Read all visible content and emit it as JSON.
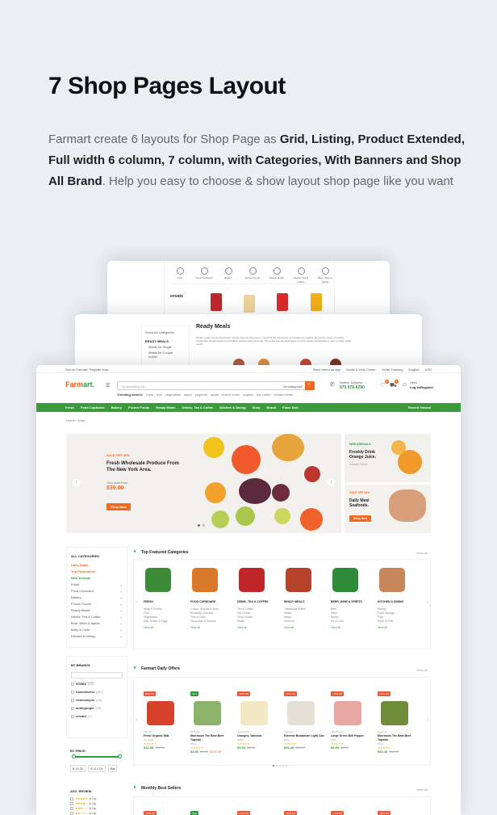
{
  "heading": "7 Shop Pages Layout",
  "intro": {
    "lead": "Farmart create 6 layouts for Shop Page as ",
    "bold": "Grid, Listing, Product Extended, Full width 6 column, 7 column, with Categories, With Banners and Shop All Brand",
    "tail": ". Help you easy to choose  & show layout shop page like you want"
  },
  "card1": {
    "categories": [
      "Fruit",
      "Food Cupboard",
      "Bakery",
      "Frozen Foods",
      "Ready Meals",
      "Drinks, Tea & Coffee",
      "Beer, Wine & Spirits"
    ],
    "brand": "envato"
  },
  "card2": {
    "sidebar_label": "Show All Categories",
    "sidebar_heading": "READY MEALS",
    "sidebar_items": [
      "Meals for Single",
      "Meals for Couple",
      "Indian"
    ],
    "title": "Ready Meals",
    "description": "Ready meals can be tempting for people who are time poor to overlook the importance of a balanced, healthy diet but the range of healthy, nutritionally sound options is constantly growing and improving. There are several advantages for busy people and families to turn to ready-made meals."
  },
  "shop": {
    "topbar_left": "Sell on Farmart: Register Now",
    "topbar_right": [
      "Store menu on app",
      "Guide & Help Center",
      "Order Tracking",
      "English",
      "USD"
    ],
    "logo_main": "Farm",
    "logo_accent": "art.",
    "search_placeholder": "I'm searching for...",
    "search_category": "All categories",
    "trending_label": "Trending search:",
    "trending": [
      "meat",
      "fruit",
      "vegetables",
      "salad",
      "yoghurts",
      "apple",
      "frozen foods",
      "organic",
      "tea coffee",
      "instant meals"
    ],
    "hotline_label": "Hotline Delivery",
    "hotline": "970 978-6290",
    "account_hello": "Hello",
    "account_login": "Log in/Register",
    "cart_count": "0",
    "wish_count": "0",
    "nav": [
      "Fresh",
      "Food Cupboard",
      "Bakery",
      "Frozen Foods",
      "Ready Meals",
      "Drinks, Tea & Coffee",
      "Kitchen & Dining",
      "Shop",
      "Brand",
      "Flash Sale"
    ],
    "nav_right": "Recent Viewed",
    "breadcrumb": "Home / Shop",
    "hero": {
      "sale": "SALE OFF 30%",
      "title": "Fresh Wholesale Produce From The New York Area.",
      "price_label": "Only start from",
      "price": "$39.00",
      "button": "Shop Now"
    },
    "banner1": {
      "tag": "NEW ARRIVALS",
      "title": "Freshly Drink Orange Juice.",
      "note": "Instant Drink"
    },
    "banner2": {
      "tag": "SALE OFF 30%",
      "title": "Daily Meal Seafoods.",
      "button": "Shop Now"
    },
    "sidebar": {
      "all_categories": "ALL CATEGORIES",
      "highlight": [
        "Daily Deals",
        "Top Promotions",
        "New Arrivals"
      ],
      "categories": [
        "Fresh",
        "Food Cupboard",
        "Bakery",
        "Frozen Foods",
        "Ready Meals",
        "Drinks, Tea & Coffee",
        "Beer, Wine & Spirits",
        "Baby & Child",
        "Kitchen & Dining"
      ],
      "by_brands": "BY BRANDS",
      "brand_search": "Search brand",
      "brands": [
        {
          "name": "envato",
          "count": "(19)"
        },
        {
          "name": "themeforest",
          "count": "(567)"
        },
        {
          "name": "codecanyon",
          "count": "(40)"
        },
        {
          "name": "audiojungle",
          "count": "(75)"
        },
        {
          "name": "envato",
          "count": "(7)"
        }
      ],
      "by_price": "BY PRICE",
      "price_min": "$ 15.00",
      "price_max": "$ 112.00",
      "price_go": "Go",
      "avg_review": "AVG. REVIEW",
      "review_rows": [
        "& Up",
        "& Up",
        "& Up",
        "& Up"
      ]
    },
    "featured": {
      "title": "Top Featured Categories",
      "view_all": "View all",
      "items": [
        {
          "name": "FRESH",
          "subs": [
            "Meat & Poultry",
            "Fruit",
            "Vegetables",
            "Milk, Butter & Eggs"
          ],
          "color": "#3d8b37"
        },
        {
          "name": "FOOD CUPBOARD",
          "subs": [
            "Crisps, Snacks & Nuts",
            "Breakfast Cereals",
            "Tins & Cans",
            "Chocolate & Sweets"
          ],
          "color": "#d97a2b"
        },
        {
          "name": "DRINK, TEA & COFFEE",
          "subs": [
            "Tea & Coffee",
            "Hot Drinks",
            "Fizzy Drinks",
            "Water"
          ],
          "color": "#c0252a"
        },
        {
          "name": "READY MEALS",
          "subs": [
            "Traditional British",
            "Indian",
            "Italian",
            "Chinese"
          ],
          "color": "#b5432b"
        },
        {
          "name": "BEER, WINE & SPIRITS",
          "subs": [
            "Beer",
            "Wine",
            "Spirits",
            "Rs & Cold"
          ],
          "color": "#2f8a3a"
        },
        {
          "name": "KITCHEN & DINING",
          "subs": [
            "Dining",
            "Food Storage",
            "Pots",
            "Pans & Pots"
          ],
          "color": "#c8875a"
        }
      ],
      "view_label": "View all"
    },
    "daily": {
      "title": "Farmart Daily Offers",
      "view_all": "View all",
      "items": [
        {
          "badge": "20% Off",
          "brand": "Farmart",
          "name": "Fresh Organic Milk",
          "unit": "4 pt pack",
          "price": "$12.99",
          "old": "$16.99",
          "color": "#e85a3a",
          "img": "#d8412b"
        },
        {
          "badge": "New",
          "brand": "Pinterest",
          "name": "Morrisons The Best Beef Topside",
          "unit": "500g",
          "price": "$4.90",
          "old": "$5.90",
          "save": "50% Off",
          "color": "#2e9c3c",
          "img": "#8bb46a"
        },
        {
          "badge": "-10% Off",
          "brand": "Alisa Farm",
          "name": "Oranges, Valencia",
          "unit": "6000m",
          "price": "$4.90",
          "old": "$5.99",
          "color": "#e85a3a",
          "img": "#f0e9c4"
        },
        {
          "badge": "-22% Off",
          "brand": "Logovue",
          "name": "Extreme Budweiser Light Can",
          "unit": "500g",
          "price": "$52.49",
          "old": "$65.99",
          "color": "#e85a3a",
          "img": "#e6e1d7"
        },
        {
          "badge": "-45% Off",
          "brand": "Alisa Farm",
          "name": "Large Green Bell Pepper",
          "unit": "500g",
          "price": "$4.99",
          "old": "$6.99",
          "color": "#e85a3a",
          "img": "#e8a7a0"
        },
        {
          "badge": "-32% Off",
          "brand": "Logovue",
          "name": "Morrisons The Best Beef Topside",
          "unit": "500g",
          "price": "$52.49",
          "old": "$66.99",
          "color": "#e85a3a",
          "img": "#6f8d3b"
        }
      ]
    },
    "monthly": {
      "title": "Monthly Best Sellers",
      "view_all": "View all",
      "badges": [
        "-45% Off",
        "New",
        "-11% Off",
        "-22% Off",
        "-12% Off",
        "-45% Off"
      ]
    }
  }
}
